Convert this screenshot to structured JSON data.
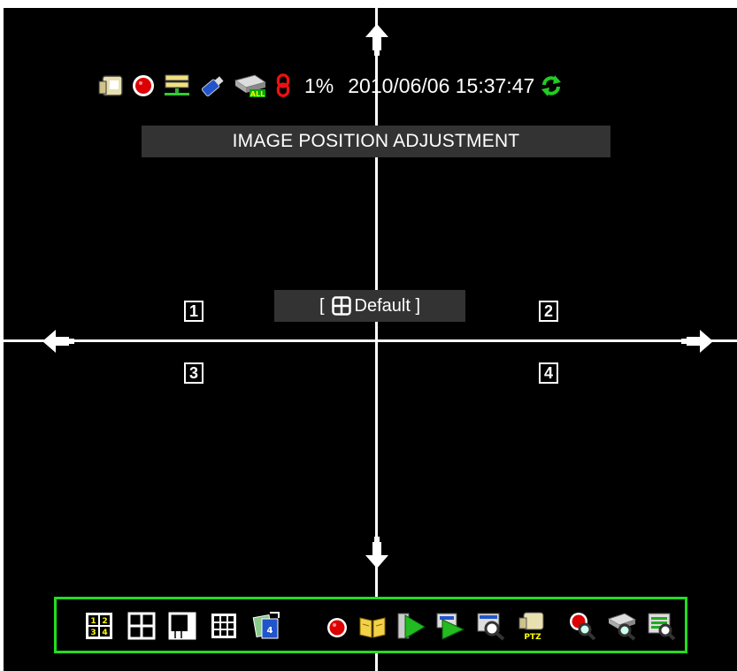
{
  "status": {
    "percent": "1%",
    "datetime": "2010/06/06 15:37:47",
    "icons": [
      "hdd-icon",
      "record-icon",
      "network-icon",
      "usb-icon",
      "backup-all-icon",
      "chain-link-icon",
      "refresh-icon"
    ]
  },
  "title": "IMAGE POSITION ADJUSTMENT",
  "default_box": {
    "open": "[",
    "label": "Default ]",
    "icon": "quad-grid-icon"
  },
  "channels": [
    "1",
    "2",
    "3",
    "4"
  ],
  "arrows": [
    "arrow-up-icon",
    "arrow-down-icon",
    "arrow-left-icon",
    "arrow-right-icon"
  ],
  "toolbar": {
    "icons": [
      "quad-view-numbered-icon",
      "quad-view-icon",
      "pip-view-icon",
      "nine-grid-view-icon",
      "sequence-view-icon",
      "record-icon",
      "event-log-icon",
      "playback-icon",
      "playback-search-icon",
      "search-icon",
      "ptz-icon",
      "record-search-icon",
      "backup-search-icon",
      "list-search-icon"
    ],
    "border_color": "#22dd22"
  }
}
